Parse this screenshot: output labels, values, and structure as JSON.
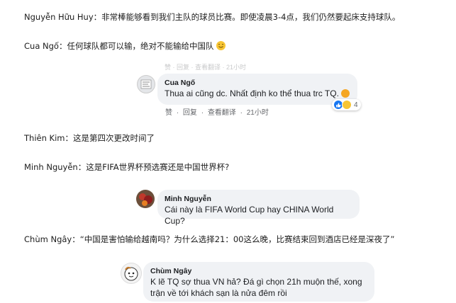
{
  "lines": [
    {
      "id": "l1",
      "name": "Nguyễn Hữu Huy",
      "sep": "：",
      "text": "非常棒能够看到我们主队的球员比赛。即使凌晨3-4点，我们仍然要起床支持球队。"
    },
    {
      "id": "l2",
      "name": "Cua Ngố",
      "sep": "：",
      "text": "任何球队都可以输，绝对不能输给中国队"
    },
    {
      "id": "l3",
      "name": "Thiên Kim",
      "sep": "：",
      "text": "这是第四次更改时间了"
    },
    {
      "id": "l4",
      "name": "Minh Nguyễn",
      "sep": "：",
      "text": "这是FIFA世界杯预选赛还是中国世界杯?"
    },
    {
      "id": "l5",
      "name": "Chùm Ngây",
      "sep": "：",
      "text": "“中国是害怕输给越南吗？为什么选择21：00这么晚，比赛结束回到酒店已经是深夜了”"
    }
  ],
  "comments": {
    "cua": {
      "name": "Cua Ngố",
      "text": "Thua ai cũng dc. Nhất định ko thể thua trc TQ.",
      "actions": [
        "赞",
        "·",
        "回复",
        "·",
        "查看翻译",
        "·",
        "21小时"
      ],
      "reaction_count": "4",
      "faded_actions": "赞 · 回复 · 查看翻译 · 21小时"
    },
    "minh": {
      "name": "Minh Nguyễn",
      "text": "Cái này là FIFA World Cup hay CHINA World Cup?"
    },
    "chum": {
      "name": "Chùm Ngây",
      "text_line1": "K lẽ TQ sợ thua VN hả? Đá gì chọn 21h muộn thế, xong",
      "text_line2": "trận về tới khách sạn là nửa đêm rồi"
    }
  },
  "colors": {
    "bubble": "#f0f2f5",
    "like_blue": "#1877f2",
    "haha_yellow": "#f7c534",
    "meta_gray": "#65676b"
  }
}
